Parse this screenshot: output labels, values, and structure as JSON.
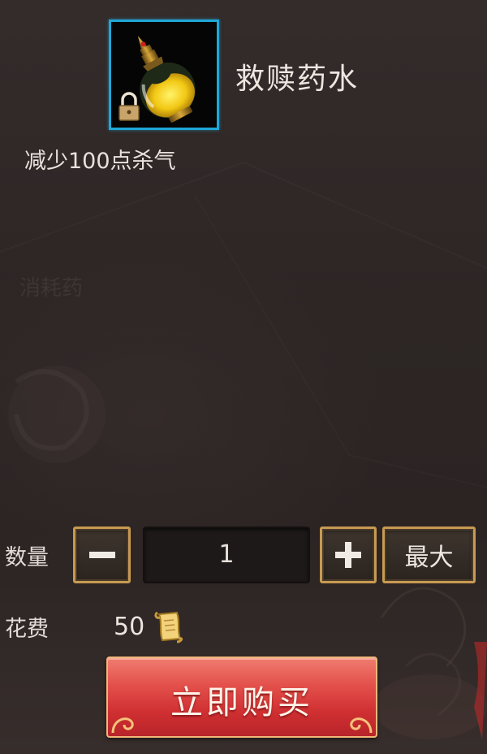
{
  "item": {
    "name": "救赎药水",
    "description": "减少100点杀气",
    "icon": "potion-bottle-icon",
    "locked": true,
    "frame_color": "#1fa8d8"
  },
  "background": {
    "faded_text": "消耗药"
  },
  "quantity": {
    "label": "数量",
    "value": "1",
    "minus_symbol": "−",
    "plus_symbol": "+",
    "max_label": "最大"
  },
  "cost": {
    "label": "花费",
    "value": "50",
    "currency_icon": "scroll-currency-icon"
  },
  "buy_button": {
    "label": "立即购买",
    "color": "#d8393a"
  }
}
